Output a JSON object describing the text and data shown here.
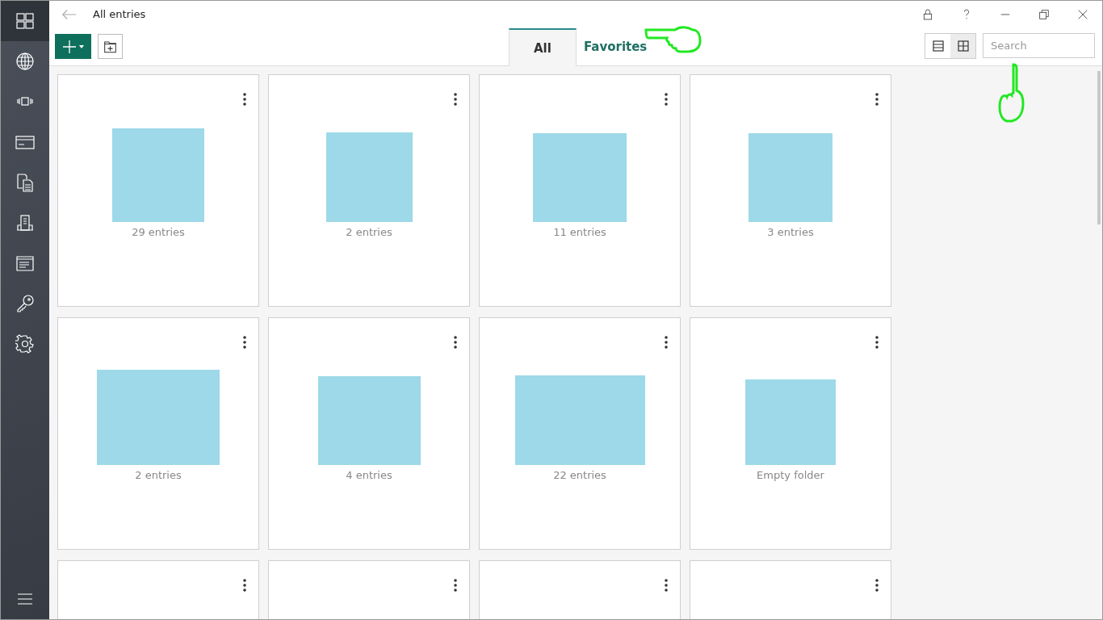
{
  "window": {
    "title": "All entries"
  },
  "tabs": [
    {
      "label": "All",
      "selected": true
    },
    {
      "label": "Favorites",
      "selected": false
    }
  ],
  "view_toggle": [
    {
      "kind": "list",
      "selected": false
    },
    {
      "kind": "grid",
      "selected": true
    }
  ],
  "search": {
    "placeholder": "Search"
  },
  "cards": [
    {
      "caption": "29 entries"
    },
    {
      "caption": "2 entries"
    },
    {
      "caption": "11 entries"
    },
    {
      "caption": "3 entries"
    },
    {
      "caption": "2 entries"
    },
    {
      "caption": "4 entries"
    },
    {
      "caption": "22 entries"
    },
    {
      "caption": "Empty folder"
    },
    {
      "kind": "cut"
    },
    {
      "kind": "cut"
    },
    {
      "kind": "cut"
    },
    {
      "kind": "cut"
    }
  ]
}
